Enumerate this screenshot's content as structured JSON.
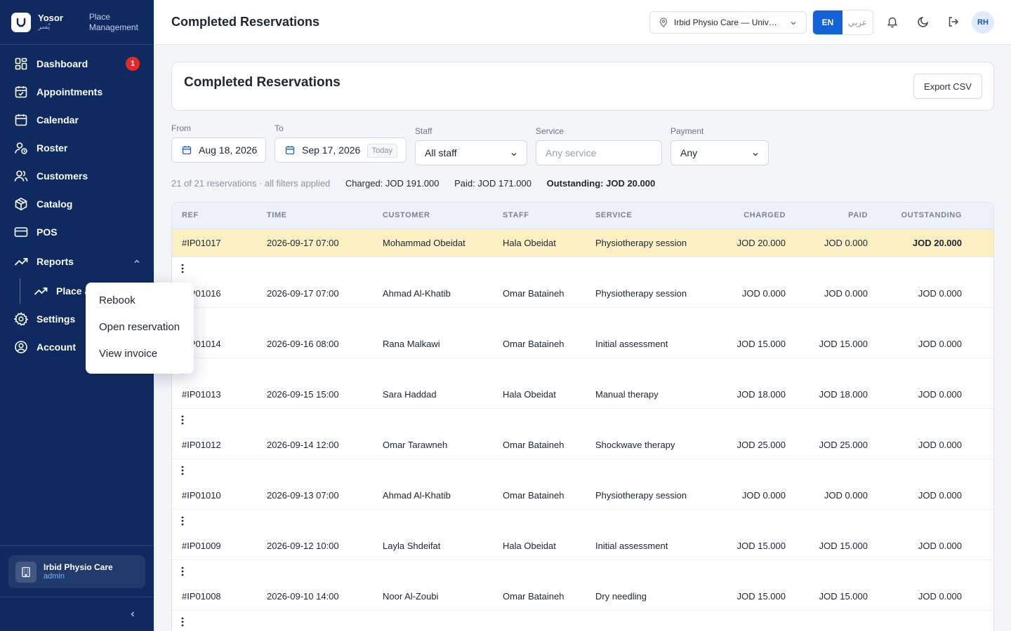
{
  "brand": {
    "name": "Yosor",
    "name_ar": "يُسر",
    "section": [
      "Place",
      "Management"
    ]
  },
  "sidebar": {
    "items": [
      {
        "label": "Dashboard",
        "badge": "1"
      },
      {
        "label": "Appointments"
      },
      {
        "label": "Calendar"
      },
      {
        "label": "Roster"
      },
      {
        "label": "Customers"
      },
      {
        "label": "Catalog"
      },
      {
        "label": "POS"
      },
      {
        "label": "Reports"
      },
      {
        "label": "Place a"
      },
      {
        "label": "Settings"
      },
      {
        "label": "Account"
      }
    ],
    "org": {
      "name": "Irbid Physio Care",
      "role": "admin"
    }
  },
  "header": {
    "title": "Completed Reservations",
    "location": "Irbid Physio Care — University Street",
    "lang_en": "EN",
    "lang_ar": "عربي",
    "avatar": "RH"
  },
  "page": {
    "title": "Completed Reservations",
    "export_label": "Export CSV"
  },
  "filters": {
    "from_label": "From",
    "from_value": "Aug 18, 2026",
    "to_label": "To",
    "to_value": "Sep 17, 2026",
    "today_label": "Today",
    "staff_label": "Staff",
    "staff_value": "All staff",
    "service_label": "Service",
    "service_placeholder": "Any service",
    "payment_label": "Payment",
    "payment_value": "Any"
  },
  "summary": {
    "count": "21 of 21 reservations · all filters applied",
    "charged": "Charged: JOD 191.000",
    "paid": "Paid: JOD 171.000",
    "outstanding": "Outstanding: JOD 20.000"
  },
  "table": {
    "columns": [
      "REF",
      "TIME",
      "CUSTOMER",
      "STAFF",
      "SERVICE",
      "CHARGED",
      "PAID",
      "OUTSTANDING"
    ],
    "rows": [
      {
        "ref": "#IP01017",
        "time": "2026-09-17 07:00",
        "customer": "Mohammad Obeidat",
        "staff": "Hala Obeidat",
        "service": "Physiotherapy session",
        "charged": "JOD 20.000",
        "paid": "JOD 0.000",
        "outstanding": "JOD 20.000"
      },
      {
        "ref": "#IP01016",
        "time": "2026-09-17 07:00",
        "customer": "Ahmad Al-Khatib",
        "staff": "Omar Bataineh",
        "service": "Physiotherapy session",
        "charged": "JOD 0.000",
        "paid": "JOD 0.000",
        "outstanding": "JOD 0.000"
      },
      {
        "ref": "#IP01014",
        "time": "2026-09-16 08:00",
        "customer": "Rana Malkawi",
        "staff": "Omar Bataineh",
        "service": "Initial assessment",
        "charged": "JOD 15.000",
        "paid": "JOD 15.000",
        "outstanding": "JOD 0.000"
      },
      {
        "ref": "#IP01013",
        "time": "2026-09-15 15:00",
        "customer": "Sara Haddad",
        "staff": "Hala Obeidat",
        "service": "Manual therapy",
        "charged": "JOD 18.000",
        "paid": "JOD 18.000",
        "outstanding": "JOD 0.000"
      },
      {
        "ref": "#IP01012",
        "time": "2026-09-14 12:00",
        "customer": "Omar Tarawneh",
        "staff": "Omar Bataineh",
        "service": "Shockwave therapy",
        "charged": "JOD 25.000",
        "paid": "JOD 25.000",
        "outstanding": "JOD 0.000"
      },
      {
        "ref": "#IP01010",
        "time": "2026-09-13 07:00",
        "customer": "Ahmad Al-Khatib",
        "staff": "Omar Bataineh",
        "service": "Physiotherapy session",
        "charged": "JOD 0.000",
        "paid": "JOD 0.000",
        "outstanding": "JOD 0.000"
      },
      {
        "ref": "#IP01009",
        "time": "2026-09-12 10:00",
        "customer": "Layla Shdeifat",
        "staff": "Hala Obeidat",
        "service": "Initial assessment",
        "charged": "JOD 15.000",
        "paid": "JOD 15.000",
        "outstanding": "JOD 0.000"
      },
      {
        "ref": "#IP01008",
        "time": "2026-09-10 14:00",
        "customer": "Noor Al-Zoubi",
        "staff": "Omar Bataineh",
        "service": "Dry needling",
        "charged": "JOD 15.000",
        "paid": "JOD 15.000",
        "outstanding": "JOD 0.000"
      }
    ]
  },
  "context_menu": {
    "items": [
      "Rebook",
      "Open reservation",
      "View invoice"
    ]
  },
  "colors": {
    "sidebar": "#0f2a60",
    "accent": "#1463d6",
    "highlight_row": "#fcf0c3",
    "badge": "#e12b2b"
  }
}
